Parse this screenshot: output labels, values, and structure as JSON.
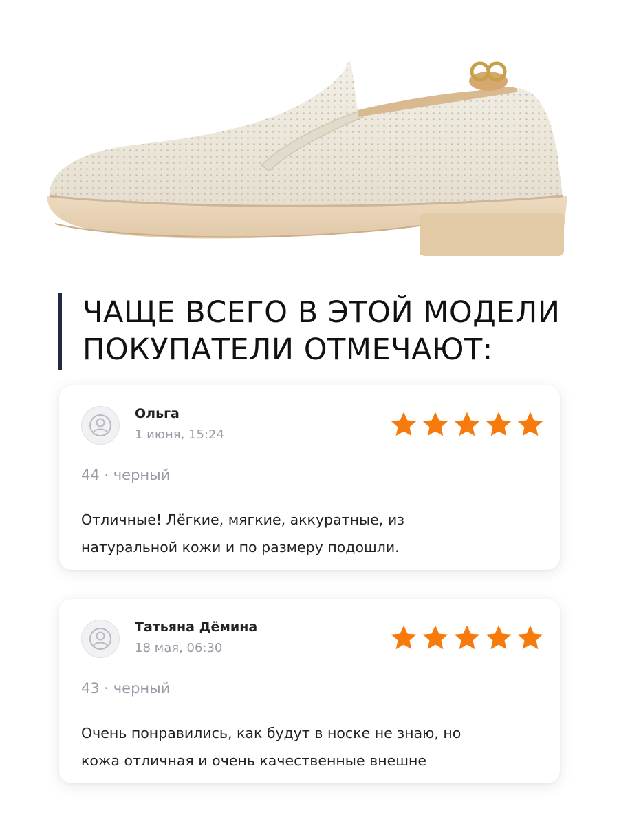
{
  "heading": {
    "line1": "ЧАЩЕ ВСЕГО В ЭТОЙ МОДЕЛИ",
    "line2": "ПОКУПАТЕЛИ ОТМЕЧАЮТ:"
  },
  "product": {
    "image_icon": "beige-perforated-loafer",
    "colors": {
      "upper": "#ede7da",
      "sole": "#e8d2b4",
      "accent_bar": "#1f2a44",
      "star": "#f77b0c"
    }
  },
  "reviews": [
    {
      "name": "Ольга",
      "date": "1 июня, 15:24",
      "rating": 5,
      "variant": "44 · черный",
      "text_lines": [
        "Отличные!  Лёгкие, мягкие, аккуратные, из",
        "натуральной кожи и по размеру подошли."
      ]
    },
    {
      "name": "Татьяна Дёмина",
      "date": "18 мая, 06:30",
      "rating": 5,
      "variant": "43 · черный",
      "text_lines": [
        "Очень понравились, как будут в носке не знаю, но",
        "кожа отличная и очень качественные внешне"
      ]
    }
  ]
}
